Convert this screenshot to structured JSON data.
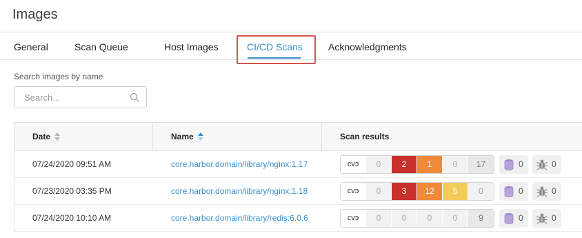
{
  "header": {
    "title": "Images"
  },
  "tabs": [
    {
      "label": "General"
    },
    {
      "label": "Scan Queue"
    },
    {
      "label": "Host Images"
    },
    {
      "label": "CI/CD Scans",
      "active": true
    },
    {
      "label": "Acknowledgments"
    }
  ],
  "search": {
    "label": "Search images by name",
    "placeholder": "Search...",
    "value": ""
  },
  "table": {
    "columns": {
      "date": "Date",
      "name": "Name",
      "scan": "Scan results"
    },
    "rows": [
      {
        "date": "07/24/2020 09:51 AM",
        "name": "core.harbor.domain/library/nginx:1.17",
        "scan": {
          "cve": "cvэ",
          "c0": "0",
          "c1": "2",
          "c2": "1",
          "c3": "0",
          "c4": "17"
        },
        "db_count": "0",
        "bug_count": "0"
      },
      {
        "date": "07/23/2020 03:35 PM",
        "name": "core.harbor.domain/library/nginx:1.18",
        "scan": {
          "cve": "cvэ",
          "c0": "0",
          "c1": "3",
          "c2": "12",
          "c3": "5",
          "c4": "0"
        },
        "db_count": "0",
        "bug_count": "0"
      },
      {
        "date": "07/24/2020 10:10 AM",
        "name": "core.harbor.domain/library/redis:6.0.6",
        "scan": {
          "cve": "cvэ",
          "c0": "0",
          "c1": "0",
          "c2": "0",
          "c3": "0",
          "c4": "9"
        },
        "db_count": "0",
        "bug_count": "0"
      }
    ]
  },
  "colors": {
    "accent": "#3a8fcf",
    "critical": "#c9302c",
    "high": "#ef8a3a",
    "medium": "#f3cb58",
    "highlight": "#d9534f"
  },
  "icons": {
    "search": "search-icon",
    "database": "database-icon",
    "bug": "bug-icon",
    "sort": "sort-icon"
  }
}
